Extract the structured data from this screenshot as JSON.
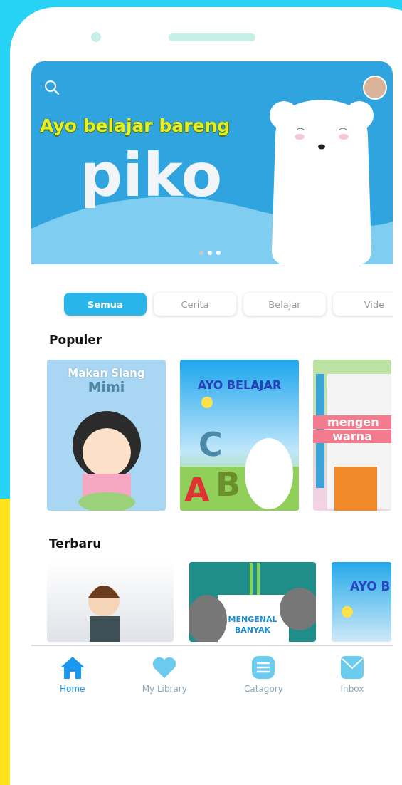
{
  "banner": {
    "headline": "Ayo belajar bareng",
    "logo_text": "piko",
    "dots": [
      {
        "selected": true
      },
      {
        "selected": false
      },
      {
        "selected": false
      }
    ]
  },
  "tabs": [
    {
      "label": "Semua",
      "selected": true
    },
    {
      "label": "Cerita",
      "selected": false
    },
    {
      "label": "Belajar",
      "selected": false
    },
    {
      "label": "Vide",
      "selected": false
    }
  ],
  "sections": [
    {
      "title": "Populer",
      "books": [
        {
          "kind": "girl",
          "title_lines": [
            "Makan Siang",
            "Mimi"
          ]
        },
        {
          "kind": "bear",
          "title_lines": [
            "AYO BELAJAR"
          ],
          "letters": [
            "C",
            "A",
            "B"
          ]
        },
        {
          "kind": "paper",
          "title_lines": [
            "mengen",
            "warna"
          ]
        }
      ]
    },
    {
      "title": "Terbaru",
      "books": [
        {
          "kind": "boy"
        },
        {
          "kind": "animals",
          "title_lines": [
            "MENGENAL",
            "BANYAK"
          ]
        },
        {
          "kind": "sky",
          "title_lines": [
            "AYO B"
          ]
        }
      ]
    }
  ],
  "nav": [
    {
      "kind": "home",
      "label": "Home",
      "selected": true
    },
    {
      "kind": "heart",
      "label": "My Library",
      "selected": false
    },
    {
      "kind": "menu",
      "label": "Catagory",
      "selected": false
    },
    {
      "kind": "mail",
      "label": "Inbox",
      "selected": false
    }
  ]
}
